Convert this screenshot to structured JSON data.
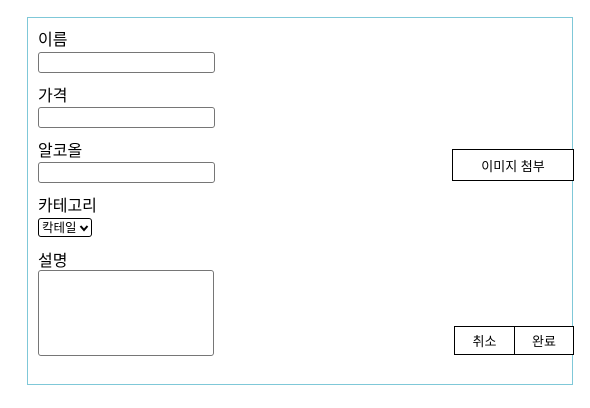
{
  "form": {
    "name": {
      "label": "이름",
      "value": ""
    },
    "price": {
      "label": "가격",
      "value": ""
    },
    "alcohol": {
      "label": "알코올",
      "value": ""
    },
    "category": {
      "label": "카테고리",
      "selected": "칵테일",
      "icon": "chevron-down-icon"
    },
    "description": {
      "label": "설명",
      "value": ""
    }
  },
  "actions": {
    "attach_image_label": "이미지 첨부",
    "cancel_label": "취소",
    "done_label": "완료"
  },
  "colors": {
    "panel_border": "#7fc8d8"
  }
}
